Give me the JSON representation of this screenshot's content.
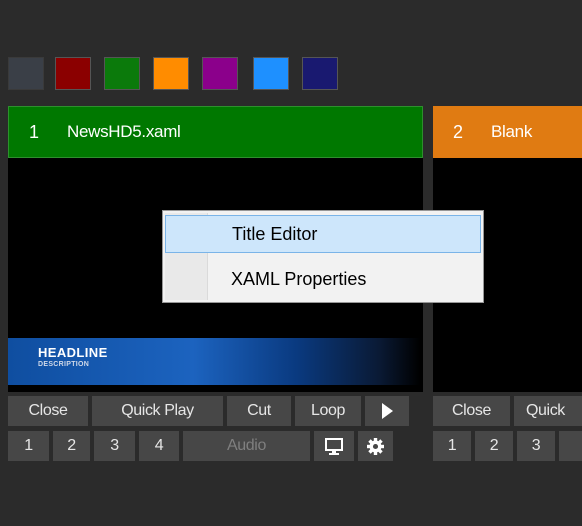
{
  "color_swatches": [
    "#3a3f47",
    "#8b0000",
    "#0b7a0b",
    "#ff8c00",
    "#8b008b",
    "#1e90ff",
    "#191970"
  ],
  "previews": [
    {
      "number": "1",
      "name": "NewsHD5.xaml",
      "header_color": "#007800",
      "lower_third": {
        "headline": "HEADLINE",
        "description": "DESCRIPTION"
      },
      "buttons_row1": [
        "Close",
        "Quick Play",
        "Cut",
        "Loop"
      ],
      "buttons_row2": [
        "1",
        "2",
        "3",
        "4",
        "Audio"
      ]
    },
    {
      "number": "2",
      "name": "Blank",
      "header_color": "#e07b12",
      "buttons_row1": [
        "Close",
        "Quick"
      ],
      "buttons_row2": [
        "1",
        "2",
        "3"
      ]
    }
  ],
  "context_menu": {
    "items": [
      {
        "label": "Title Editor",
        "highlighted": true
      },
      {
        "label": "XAML Properties",
        "highlighted": false
      }
    ]
  }
}
